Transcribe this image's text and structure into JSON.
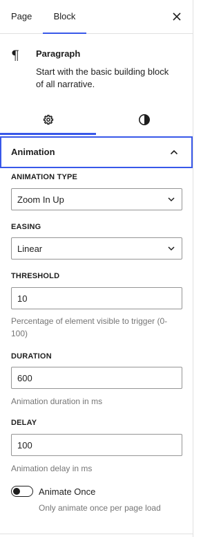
{
  "tabs": {
    "page_label": "Page",
    "block_label": "Block"
  },
  "block_card": {
    "icon": "paragraph-icon",
    "title": "Paragraph",
    "description": "Start with the basic building block of all narrative."
  },
  "sub_tabs": {
    "settings_icon": "gear-icon",
    "styles_icon": "half-circle-contrast-icon"
  },
  "panel": {
    "title": "Animation",
    "expanded": true
  },
  "fields": {
    "animation_type": {
      "label": "Animation Type",
      "value": "Zoom In Up"
    },
    "easing": {
      "label": "Easing",
      "value": "Linear"
    },
    "threshold": {
      "label": "Threshold",
      "value": "10",
      "help": "Percentage of element visible to trigger (0-100)"
    },
    "duration": {
      "label": "Duration",
      "value": "600",
      "help": "Animation duration in ms"
    },
    "delay": {
      "label": "Delay",
      "value": "100",
      "help": "Animation delay in ms"
    }
  },
  "animate_once": {
    "label": "Animate Once",
    "help": "Only animate once per page load",
    "checked": false
  },
  "colors": {
    "accent": "#3858e9",
    "text": "#1e1e1e",
    "muted": "#757575",
    "border": "#949494"
  }
}
